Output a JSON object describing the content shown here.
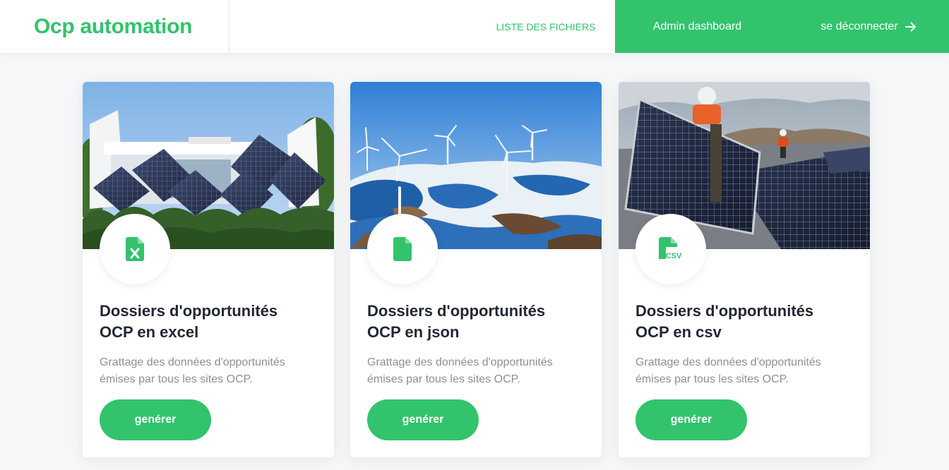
{
  "navbar": {
    "brand": "Ocp automation",
    "links": {
      "files": "LISTE DES FICHIERS",
      "admin": "Admin dashboard",
      "logout": "se déconnecter"
    }
  },
  "colors": {
    "accent": "#32c36c",
    "title": "#222733",
    "muted": "#8d8f94"
  },
  "cards": [
    {
      "image": "solar-panels-building",
      "icon": "excel-file-icon",
      "title_line1": "Dossiers d'opportunités",
      "title_line2": "OCP en excel",
      "desc_line1": "Grattage des données d'opportunités",
      "desc_line2": "émises par tous les sites OCP.",
      "button": "genérer"
    },
    {
      "image": "wind-turbines-snowy-hills",
      "icon": "json-file-icon",
      "title_line1": "Dossiers d'opportunités",
      "title_line2": "OCP en json",
      "desc_line1": "Grattage des données d'opportunités",
      "desc_line2": "émises par tous les sites OCP.",
      "button": "genérer"
    },
    {
      "image": "workers-installing-solar-panels",
      "icon": "csv-file-icon",
      "icon_text": "CSV",
      "title_line1": "Dossiers d'opportunités",
      "title_line2": "OCP en csv",
      "desc_line1": "Grattage des données d'opportunités",
      "desc_line2": "émises par tous les sites OCP.",
      "button": "genérer"
    }
  ]
}
